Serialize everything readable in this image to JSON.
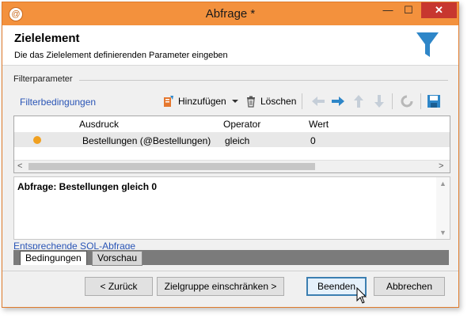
{
  "window": {
    "title": "Abfrage *",
    "minimize": "—",
    "maximize": "☐",
    "close": "✕"
  },
  "header": {
    "title": "Zielelement",
    "subtitle": "Die das Zielelement definierenden Parameter eingeben"
  },
  "filter": {
    "section_label": "Filterparameter",
    "conditions_label": "Filterbedingungen",
    "add_label": "Hinzufügen",
    "delete_label": "Löschen"
  },
  "grid": {
    "columns": [
      "Ausdruck",
      "Operator",
      "Wert"
    ],
    "rows": [
      {
        "expression": "Bestellungen (@Bestellungen)",
        "operator": "gleich",
        "value": "0"
      }
    ]
  },
  "query": {
    "text": "Abfrage: Bestellungen gleich 0"
  },
  "sql_link": "Entsprechende SQL-Abfrage",
  "tabs": [
    {
      "label": "Bedingungen"
    },
    {
      "label": "Vorschau"
    }
  ],
  "buttons": {
    "back": "< Zurück",
    "restrict": "Zielgruppe einschränken >",
    "finish": "Beenden",
    "cancel": "Abbrechen"
  },
  "colors": {
    "titlebar": "#f3913d",
    "accent": "#2a55b6",
    "status_dot": "#f0a020",
    "funnel": "#2e86c8"
  }
}
